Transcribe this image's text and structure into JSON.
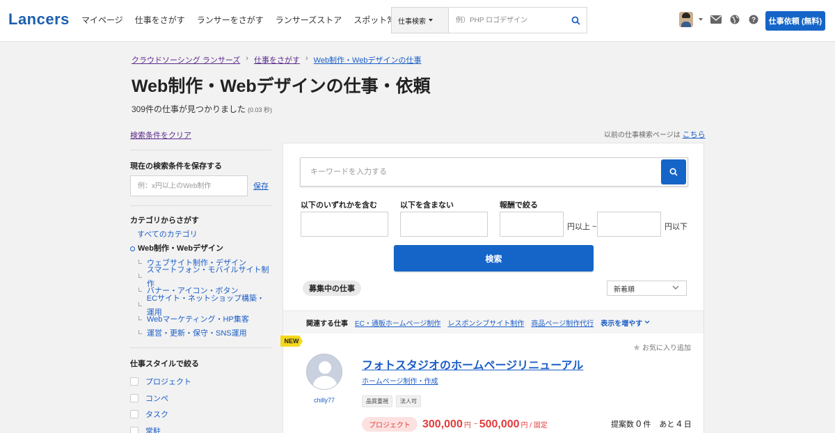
{
  "header": {
    "logo": "Lancers",
    "nav": [
      "マイページ",
      "仕事をさがす",
      "ランサーをさがす",
      "ランサーズストア",
      "スポット常駐"
    ],
    "search_type": "仕事検索",
    "search_placeholder": "例）PHP ロゴデザイン",
    "order_button": "仕事依頼 (無料)"
  },
  "breadcrumb": [
    "クラウドソーシング ランサーズ",
    "仕事をさがす",
    "Web制作・Webデザインの仕事"
  ],
  "page_title": "Web制作・Webデザインの仕事・依頼",
  "result_count": "309件の仕事が見つかりました",
  "result_time": "(0.03 秒)",
  "sidebar": {
    "clear_link": "検索条件をクリア",
    "save_heading": "現在の検索条件を保存する",
    "save_placeholder": "例：x円以上のWeb制作",
    "save_link": "保存",
    "category_heading": "カテゴリからさがす",
    "all_categories": "すべてのカテゴリ",
    "current_category": "Web制作・Webデザイン",
    "subcategories": [
      "ウェブサイト制作・デザイン",
      "スマートフォン・モバイルサイト制作",
      "バナー・アイコン・ボタン",
      "ECサイト・ネットショップ構築・運用",
      "Webマーケティング・HP集客",
      "運営・更新・保守・SNS運用"
    ],
    "style_heading": "仕事スタイルで絞る",
    "styles": [
      "プロジェクト",
      "コンペ",
      "タスク",
      "常駐"
    ]
  },
  "prev_search": {
    "text": "以前の仕事検索ページは",
    "link": "こちら"
  },
  "search_form": {
    "keyword_placeholder": "キーワードを入力する",
    "include_label": "以下のいずれかを含む",
    "exclude_label": "以下を含まない",
    "reward_label": "報酬で絞る",
    "min_unit": "円以上 ~",
    "max_unit": "円以下",
    "submit": "検索"
  },
  "list": {
    "tab": "募集中の仕事",
    "sort": "新着順",
    "related_label": "関連する仕事",
    "related_links": [
      "EC・通販ホームページ制作",
      "レスポンシブサイト制作",
      "商品ページ制作代行"
    ],
    "more": "表示を増やす"
  },
  "job": {
    "badge": "NEW",
    "favorite": "お気に入り追加",
    "client": "chilly77",
    "title": "フォトスタジオのホームページリニューアル",
    "category": "ホームページ制作・作成",
    "tags": [
      "品質重視",
      "法人可"
    ],
    "type": "プロジェクト",
    "price_min": "300,000",
    "price_max": "500,000",
    "yen": "円",
    "tilde": "~",
    "fixed": "円 / 固定",
    "proposals_label": "提案数",
    "proposals": "0",
    "count_unit": "件",
    "remaining_label": "あと",
    "remaining": "4",
    "day_unit": "日"
  },
  "colors": {
    "brand": "#1565c8",
    "price": "#e23b3b",
    "badge": "#f5d81e"
  }
}
